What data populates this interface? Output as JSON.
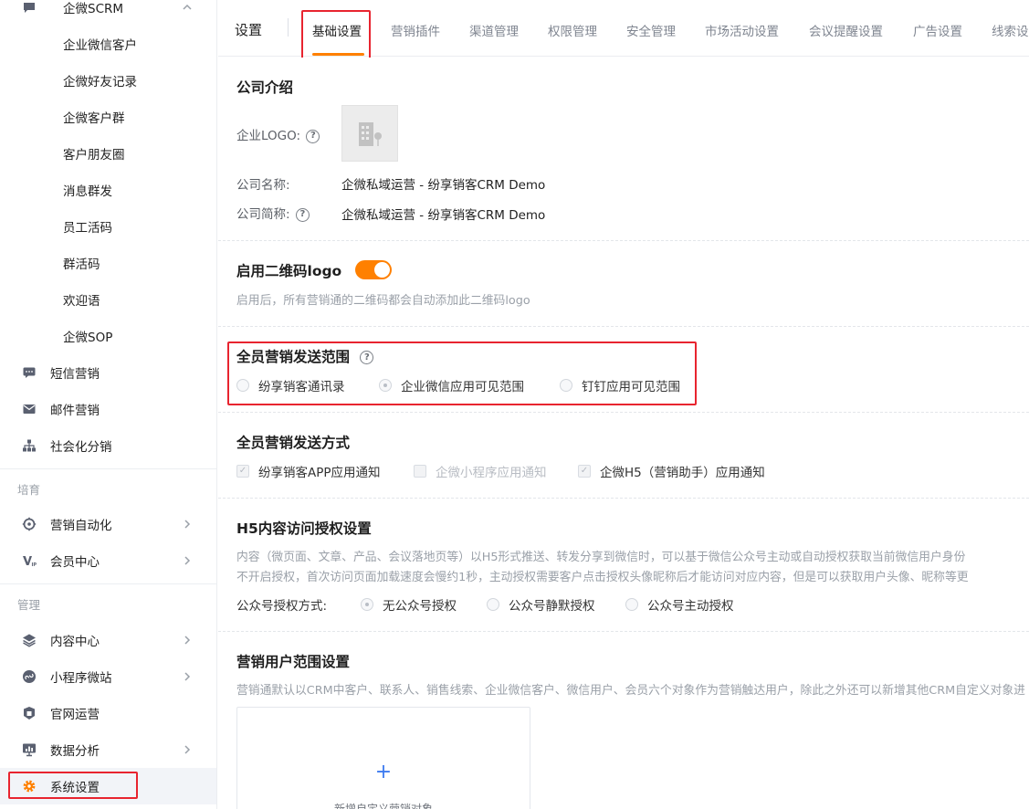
{
  "sidebar": {
    "group_title": "企微SCRM",
    "sub_items": [
      "企业微信客户",
      "企微好友记录",
      "企微客户群",
      "客户朋友圈",
      "消息群发",
      "员工活码",
      "群活码",
      "欢迎语",
      "企微SOP"
    ],
    "items_a": [
      {
        "label": "短信营销",
        "icon": "message-icon"
      },
      {
        "label": "邮件营销",
        "icon": "mail-icon"
      },
      {
        "label": "社会化分销",
        "icon": "org-tree-icon"
      }
    ],
    "section_cultivate": "培育",
    "items_b": [
      {
        "label": "营销自动化",
        "icon": "automation-icon"
      },
      {
        "label": "会员中心",
        "icon": "vip-icon"
      }
    ],
    "section_manage": "管理",
    "items_c": [
      {
        "label": "内容中心",
        "icon": "layers-icon"
      },
      {
        "label": "小程序微站",
        "icon": "mini-program-icon"
      },
      {
        "label": "官网运营",
        "icon": "website-icon"
      },
      {
        "label": "数据分析",
        "icon": "chart-icon"
      },
      {
        "label": "系统设置",
        "icon": "gear-icon"
      }
    ]
  },
  "header": {
    "title": "设置",
    "tabs": [
      "基础设置",
      "营销插件",
      "渠道管理",
      "权限管理",
      "安全管理",
      "市场活动设置",
      "会议提醒设置",
      "广告设置",
      "线索设"
    ]
  },
  "company": {
    "title": "公司介绍",
    "logo_label": "企业LOGO:",
    "name_label": "公司名称:",
    "name_value": "企微私域运营 - 纷享销客CRM Demo",
    "short_label": "公司简称:",
    "short_value": "企微私域运营 - 纷享销客CRM Demo"
  },
  "qr": {
    "title": "启用二维码logo",
    "desc": "启用后，所有营销通的二维码都会自动添加此二维码logo"
  },
  "scope": {
    "title": "全员营销发送范围",
    "options": [
      "纷享销客通讯录",
      "企业微信应用可见范围",
      "钉钉应用可见范围"
    ]
  },
  "method": {
    "title": "全员营销发送方式",
    "options": [
      "纷享销客APP应用通知",
      "企微小程序应用通知",
      "企微H5（营销助手）应用通知"
    ]
  },
  "h5": {
    "title": "H5内容访问授权设置",
    "desc1": "内容（微页面、文章、产品、会议落地页等）以H5形式推送、转发分享到微信时，可以基于微信公众号主动或自动授权获取当前微信用户身份",
    "desc2": "不开启授权，首次访问页面加载速度会慢约1秒，主动授权需要客户点击授权头像昵称后才能访问对应内容，但是可以获取用户头像、昵称等更",
    "auth_label": "公众号授权方式:",
    "options": [
      "无公众号授权",
      "公众号静默授权",
      "公众号主动授权"
    ]
  },
  "user_scope": {
    "title": "营销用户范围设置",
    "desc": "营销通默认以CRM中客户、联系人、销售线索、企业微信客户、微信用户、会员六个对象作为营销触达用户，除此之外还可以新增其他CRM自定义对象进",
    "add_icon": "+",
    "add_label": "新增自定义营销对象"
  },
  "colors": {
    "accent": "#ff8000",
    "highlight": "#e8242f",
    "link": "#3d7bf0"
  }
}
